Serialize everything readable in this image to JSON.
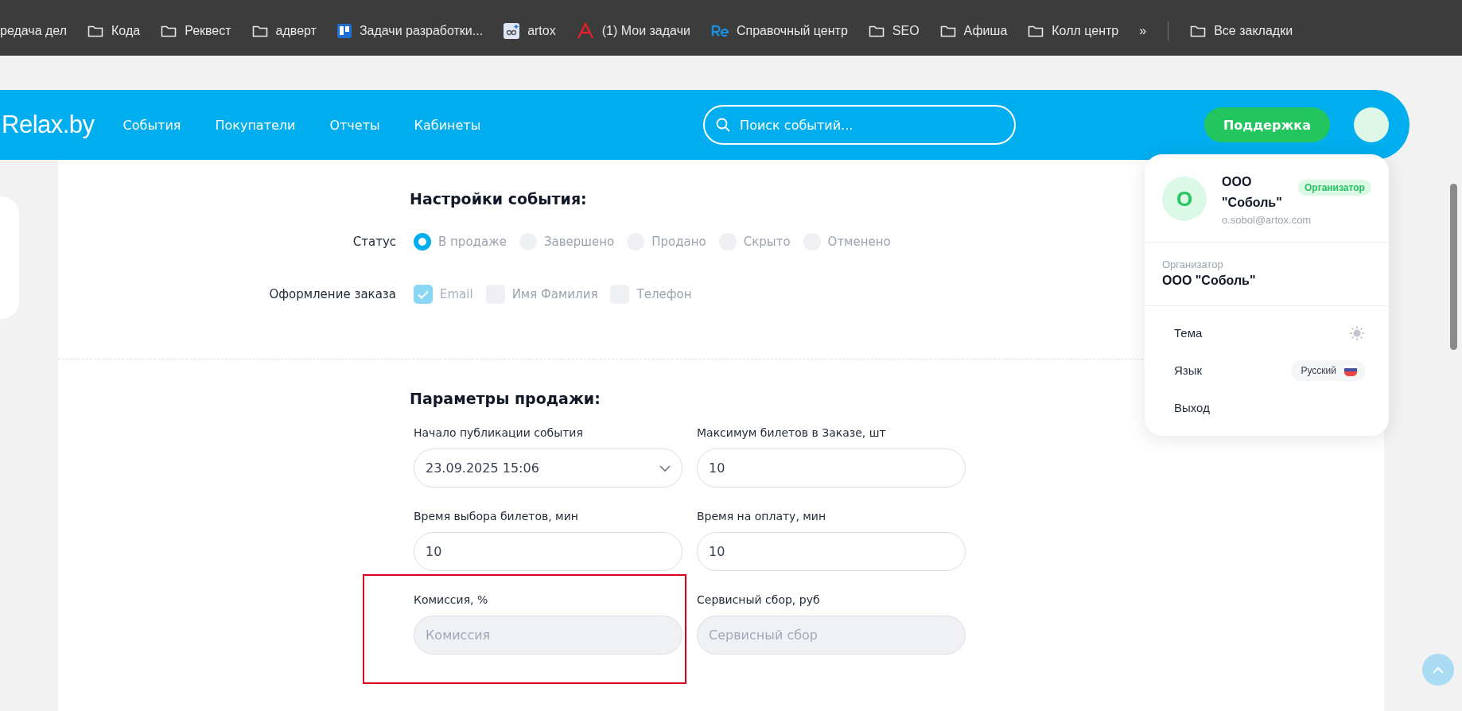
{
  "bookmarks": [
    {
      "kind": "text",
      "label": "редача дел"
    },
    {
      "kind": "folder",
      "label": "Кода"
    },
    {
      "kind": "folder",
      "label": "Реквест"
    },
    {
      "kind": "folder",
      "label": "адверт"
    },
    {
      "kind": "board",
      "label": "Задачи разработки..."
    },
    {
      "kind": "note",
      "label": "artox"
    },
    {
      "kind": "letter",
      "label": "(1) Мои задачи"
    },
    {
      "kind": "re",
      "label": "Справочный центр"
    },
    {
      "kind": "folder",
      "label": "SEO"
    },
    {
      "kind": "folder",
      "label": "Афиша"
    },
    {
      "kind": "folder",
      "label": "Колл центр"
    }
  ],
  "bookmarks_more": "»",
  "bookmarks_all": "Все закладки",
  "header": {
    "logo": "Relax.by",
    "nav": [
      "События",
      "Покупатели",
      "Отчеты",
      "Кабинеты"
    ],
    "search": {
      "placeholder": "Поиск событий..."
    },
    "support": "Поддержка"
  },
  "settings": {
    "title": "Настройки события:",
    "status": {
      "label": "Статус",
      "options": [
        {
          "label": "В продаже",
          "selected": true
        },
        {
          "label": "Завершено",
          "selected": false
        },
        {
          "label": "Продано",
          "selected": false
        },
        {
          "label": "Скрыто",
          "selected": false
        },
        {
          "label": "Отменено",
          "selected": false
        }
      ]
    },
    "order": {
      "label": "Оформление заказа",
      "options": [
        {
          "label": "Email",
          "checked": true,
          "disabled": true
        },
        {
          "label": "Имя Фамилия",
          "checked": false,
          "disabled": false
        },
        {
          "label": "Телефон",
          "checked": false,
          "disabled": false
        }
      ]
    }
  },
  "sale": {
    "title": "Параметры продажи:",
    "fields": [
      {
        "kind": "select",
        "label": "Начало публикации события",
        "value": "23.09.2025 15:06",
        "disabled": false,
        "highlighted": false
      },
      {
        "kind": "input",
        "label": "Максимум билетов в Заказе, шт",
        "value": "10",
        "disabled": false,
        "highlighted": false
      },
      {
        "kind": "input",
        "label": "Время выбора билетов, мин",
        "value": "10",
        "disabled": false,
        "highlighted": false
      },
      {
        "kind": "input",
        "label": "Время на оплату, мин",
        "value": "10",
        "disabled": false,
        "highlighted": false
      },
      {
        "kind": "input",
        "label": "Комиссия, %",
        "placeholder": "Комиссия",
        "disabled": true,
        "highlighted": true
      },
      {
        "kind": "input",
        "label": "Сервисный сбор, руб",
        "placeholder": "Сервисный сбор",
        "disabled": true,
        "highlighted": false
      }
    ]
  },
  "account_menu": {
    "avatar": "О",
    "name": "ООО \"Соболь\"",
    "role_badge": "Организатор",
    "email": "o.sobol@artox.com",
    "org_label": "Организатор",
    "org_name": "ООО \"Соболь\"",
    "items": [
      {
        "kind": "theme",
        "label": "Тема"
      },
      {
        "kind": "language",
        "label": "Язык",
        "value": "Русский"
      },
      {
        "kind": "plain",
        "label": "Выход"
      }
    ]
  }
}
